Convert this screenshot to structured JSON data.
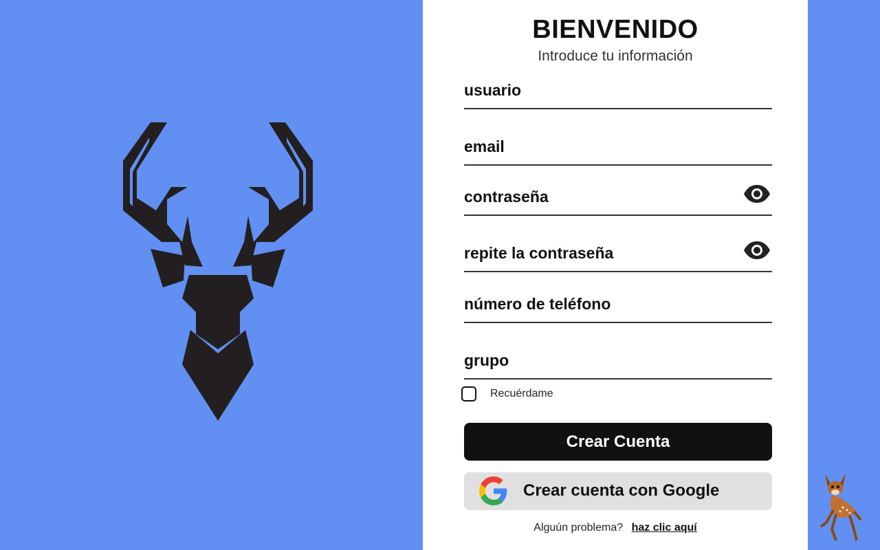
{
  "form": {
    "title": "BIENVENIDO",
    "subtitle": "Introduce tu información",
    "fields": [
      {
        "label": "usuario"
      },
      {
        "label": "email"
      },
      {
        "label": "contraseña",
        "icon": "eye-icon"
      },
      {
        "label": "repite la contraseña",
        "icon": "eye-icon"
      },
      {
        "label": "número de teléfono"
      },
      {
        "label": "grupo"
      }
    ],
    "remember_label": "Recuérdame",
    "create_button": "Crear Cuenta",
    "google_button": "Crear cuenta con Google",
    "help_text": "Alguún problema?",
    "help_link": "haz clic aquí"
  },
  "colors": {
    "background": "#6190f2",
    "panel": "#ffffff",
    "primary_button": "#111111",
    "google_button": "#e0e0e0"
  },
  "icons": [
    "deer-logo",
    "eye-icon",
    "google-icon",
    "bambi-mascot"
  ]
}
